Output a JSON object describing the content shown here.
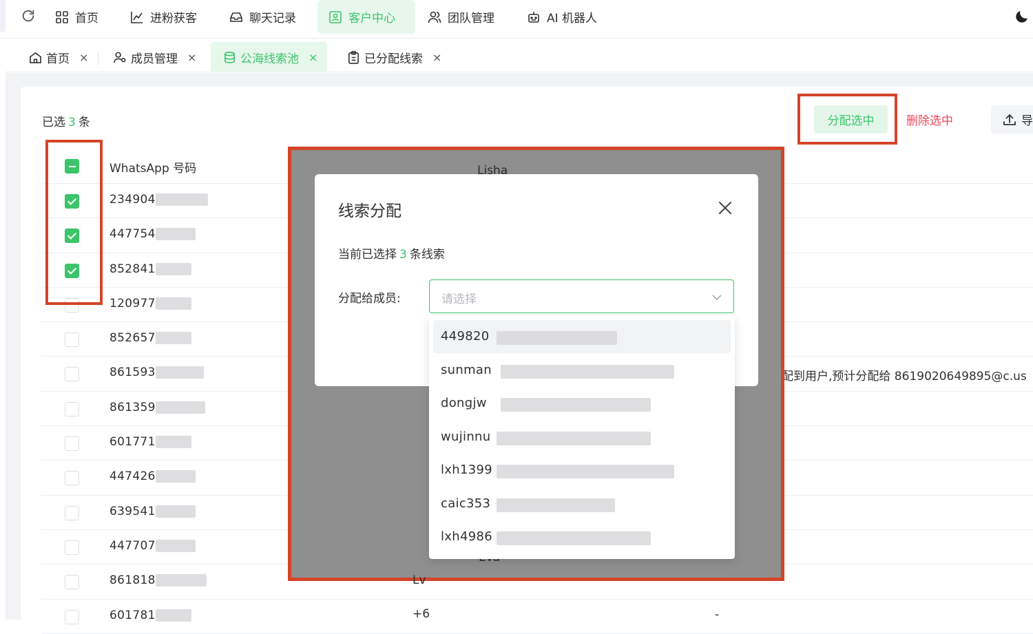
{
  "topnav": {
    "items": [
      {
        "label": "首页",
        "icon": "grid-icon"
      },
      {
        "label": "进粉获客",
        "icon": "chart-icon"
      },
      {
        "label": "聊天记录",
        "icon": "inbox-icon"
      },
      {
        "label": "客户中心",
        "icon": "contact-icon",
        "active": true
      },
      {
        "label": "团队管理",
        "icon": "team-icon"
      },
      {
        "label": "AI 机器人",
        "icon": "robot-icon"
      }
    ]
  },
  "tabs": [
    {
      "label": "首页",
      "icon": "home-icon",
      "close": "×"
    },
    {
      "label": "成员管理",
      "icon": "member-icon",
      "close": "×"
    },
    {
      "label": "公海线索池",
      "icon": "database-icon",
      "close": "×",
      "active": true
    },
    {
      "label": "已分配线索",
      "icon": "clipboard-icon",
      "close": "×"
    }
  ],
  "toolbar": {
    "selected_prefix": "已选",
    "selected_count": "3",
    "selected_suffix": "条",
    "assign_label": "分配选中",
    "delete_label": "删除选中",
    "export_label": "导"
  },
  "table": {
    "header_phone": "WhatsApp 号码",
    "rows": [
      {
        "phone": "234904",
        "checked": true
      },
      {
        "phone": "447754",
        "checked": true
      },
      {
        "phone": "852841",
        "checked": true
      },
      {
        "phone": "120977",
        "checked": false
      },
      {
        "phone": "852657",
        "checked": false
      },
      {
        "phone": "861593",
        "checked": false,
        "note": "配到用户,预计分配给 8619020649895@c.us"
      },
      {
        "phone": "861359",
        "checked": false
      },
      {
        "phone": "601771",
        "checked": false
      },
      {
        "phone": "447426",
        "checked": false
      },
      {
        "phone": "639541",
        "checked": false
      },
      {
        "phone": "447707",
        "checked": false
      },
      {
        "phone": "861818",
        "checked": false,
        "dash": "-"
      },
      {
        "phone": "601781",
        "checked": false,
        "dash": "-"
      }
    ]
  },
  "background_ghosts": {
    "lisha": "Lisha",
    "eva": "Eva",
    "lv": "Lv",
    "plus": "+6"
  },
  "dialog": {
    "title": "线索分配",
    "info_prefix": "当前已选择",
    "info_count": "3",
    "info_suffix": "条线索",
    "member_label": "分配给成员:",
    "select_placeholder": "请选择",
    "options": [
      "449820",
      "sunman",
      "dongjw",
      "wujinnu",
      "lxh1399",
      "caic353",
      "lxh4986"
    ]
  },
  "colors": {
    "accent": "#3cc46a",
    "danger": "#f0465b",
    "highlight_border": "#d44427",
    "overlay": "#8f8f8f"
  }
}
